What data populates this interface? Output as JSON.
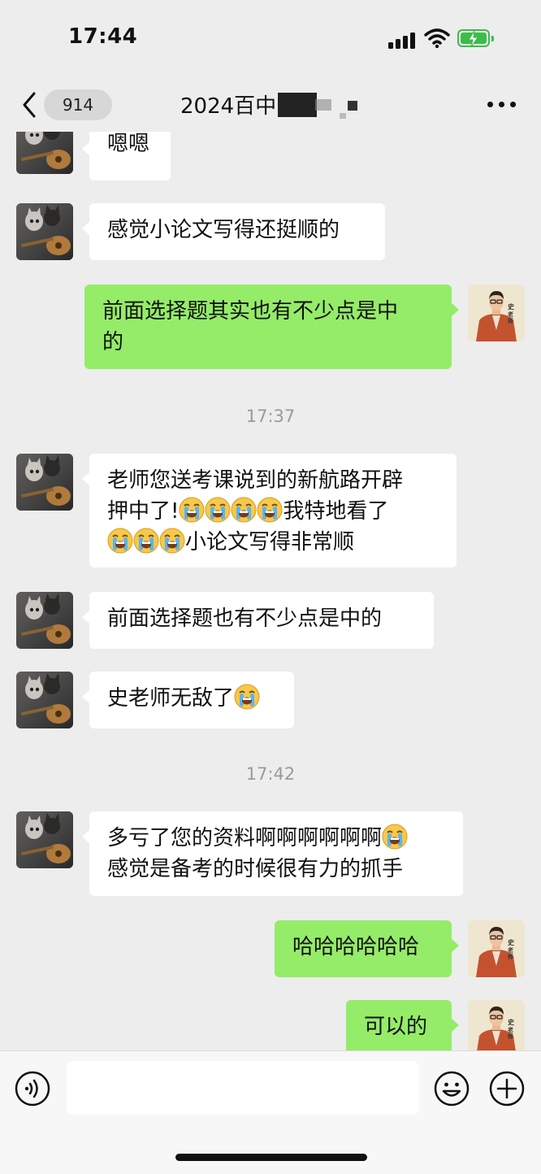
{
  "status_bar": {
    "time": "17:44",
    "battery_state": "charging",
    "battery_color": "#3cbc4a"
  },
  "nav": {
    "unread_count": "914",
    "title": "2024百中",
    "back_icon": "chevron-left-icon",
    "more_icon": "more-dots-icon"
  },
  "colors": {
    "background": "#ededed",
    "incoming_bubble": "#ffffff",
    "outgoing_bubble": "#95ec69",
    "timestamp": "#9a9a9a"
  },
  "messages": [
    {
      "from": "other",
      "text": "嗯嗯"
    },
    {
      "from": "other",
      "text": "感觉小论文写得还挺顺的"
    },
    {
      "from": "me",
      "line1": "前面选择题其实也有不少点是中",
      "line2": "的"
    },
    {
      "type": "time",
      "text": "17:37"
    },
    {
      "from": "other",
      "line1": "老师您送考课说到的新航路开辟",
      "line2a": "押中了!",
      "line2b": "我特地看了",
      "line3": "小论文写得非常顺"
    },
    {
      "from": "other",
      "text": "前面选择题也有不少点是中的"
    },
    {
      "from": "other",
      "text": "史老师无敌了"
    },
    {
      "type": "time",
      "text": "17:42"
    },
    {
      "from": "other",
      "line1": "多亏了您的资料啊啊啊啊啊啊",
      "line2": "感觉是备考的时候很有力的抓手"
    },
    {
      "from": "me",
      "text": "哈哈哈哈哈哈"
    },
    {
      "from": "me",
      "text": "可以的"
    }
  ],
  "teacher_avatar_text": "史老师",
  "input_bar": {
    "placeholder": "",
    "voice_icon": "voice-icon",
    "emoji_icon": "emoji-icon",
    "plus_icon": "plus-icon"
  }
}
